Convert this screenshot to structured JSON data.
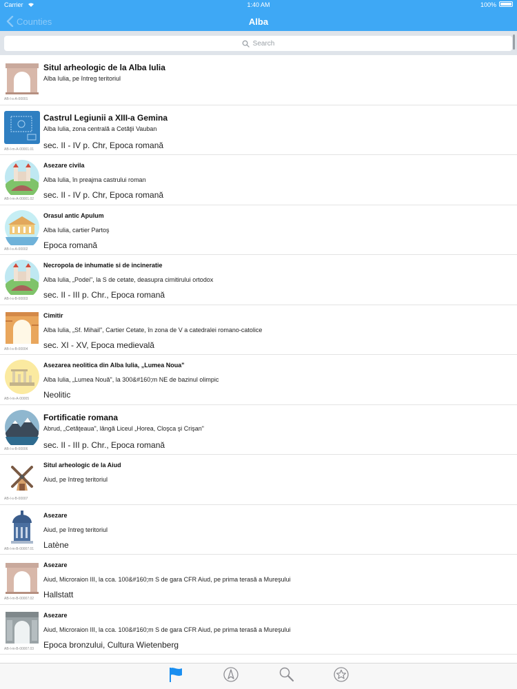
{
  "status": {
    "carrier": "Carrier",
    "time": "1:40 AM",
    "battery": "100%"
  },
  "nav": {
    "back_label": "Counties",
    "title": "Alba"
  },
  "search": {
    "placeholder": "Search"
  },
  "items": [
    {
      "title": "Situl arheologic de la Alba Iulia",
      "location": "Alba Iulia, pe întreg teritoriul",
      "period": "",
      "code": "AB-I-s-A-00001",
      "icon": "arch-icon",
      "big": true
    },
    {
      "title": "Castrul Legiunii a XIII-a Gemina",
      "location": "Alba Iulia, zona centrală a Cetăţii Vauban",
      "period": "sec. II - IV p. Chr, Epoca romană",
      "code": "AB-I-m-A-00001.01",
      "icon": "blueprint-icon",
      "big": true
    },
    {
      "title": "Asezare civila",
      "location": "Alba Iulia, în preajma castrului roman",
      "period": "sec. II - IV p. Chr, Epoca romană",
      "code": "AB-I-m-A-00001.02",
      "icon": "castle-hill-icon",
      "big": false
    },
    {
      "title": "Orasul antic Apulum",
      "location": "Alba Iulia, cartier Partoş",
      "period": "Epoca romană",
      "code": "AB-I-s-A-00002",
      "icon": "ancient-city-icon",
      "big": false
    },
    {
      "title": "Necropola de inhumatie si de incineratie",
      "location": "Alba Iulia, „Podei\", la S de cetate, deasupra cimitirului ortodox",
      "period": "sec. II - III p. Chr., Epoca romană",
      "code": "AB-I-s-B-00003",
      "icon": "castle-hill-icon",
      "big": false
    },
    {
      "title": "Cimitir",
      "location": "Alba Iulia, „Sf. Mihail\", Cartier Cetate, în zona de V a catedralei romano-catolice",
      "period": "sec. XI - XV, Epoca medievală",
      "code": "AB-I-s-B-00004",
      "icon": "brick-arch-icon",
      "big": false
    },
    {
      "title": "Asezarea neolitica din Alba Iulia, „Lumea Noua\"",
      "location": "Alba Iulia, „Lumea Nouă\", la 300&#160;m NE de bazinul olimpic",
      "period": "Neolitic",
      "code": "AB-I-m-A-00005",
      "icon": "ruins-icon",
      "big": false
    },
    {
      "title": "Fortificatie romana",
      "location": "Abrud, „Cetăţeaua\", lângă Liceul „Horea, Cloşca şi Crişan\"",
      "period": "sec. II - III p. Chr., Epoca romană",
      "code": "AB-I-s-B-00006",
      "icon": "mountain-icon",
      "big": true
    },
    {
      "title": "Situl arheologic de la Aiud",
      "location": "Aiud, pe întreg teritoriul",
      "period": "",
      "code": "AB-I-s-B-00007",
      "icon": "windmill-icon",
      "big": false
    },
    {
      "title": "Asezare",
      "location": "Aiud, pe întreg teritoriul",
      "period": "Latène",
      "code": "AB-I-m-B-00007.01",
      "icon": "dome-icon",
      "big": false
    },
    {
      "title": "Asezare",
      "location": "Aiud, Microraion III, la cca. 100&#160;m S de gara CFR Aiud, pe prima terasă a Mureşului",
      "period": "Hallstatt",
      "code": "AB-I-m-B-00007.02",
      "icon": "arch-icon",
      "big": false
    },
    {
      "title": "Asezare",
      "location": "Aiud, Microraion III, la cca. 100&#160;m S de gara CFR Aiud, pe prima terasă a Mureşului",
      "period": "Epoca bronzului, Cultura Wietenberg",
      "code": "AB-I-m-B-00007.03",
      "icon": "triumph-arch-icon",
      "big": false
    }
  ],
  "tabs": [
    {
      "name": "tab-flag",
      "icon": "flag-icon"
    },
    {
      "name": "tab-nearby",
      "icon": "compass-icon"
    },
    {
      "name": "tab-search",
      "icon": "magnifier-icon"
    },
    {
      "name": "tab-favorites",
      "icon": "star-icon"
    }
  ],
  "colors": {
    "nav": "#3ea8f5",
    "tab_active": "#1a8ef0",
    "tab_inactive": "#8e8e93"
  }
}
